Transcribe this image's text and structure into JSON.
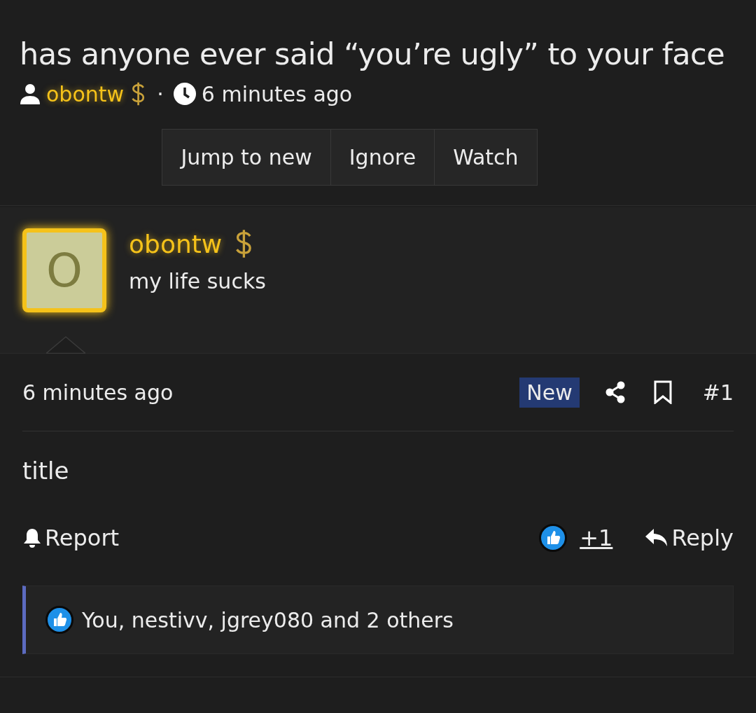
{
  "thread": {
    "title": "has anyone ever said “you’re ugly” to your face",
    "author": "obontw",
    "separator": "·",
    "time": "6 minutes ago"
  },
  "thread_buttons": [
    {
      "label": "Jump to new"
    },
    {
      "label": "Ignore"
    },
    {
      "label": "Watch"
    }
  ],
  "post": {
    "avatar_letter": "O",
    "username": "obontw",
    "user_title": "my life sucks",
    "time": "6 minutes ago",
    "badge": "New",
    "number": "#1",
    "body": "title",
    "report": "Report",
    "reaction_count": "+1",
    "reply": "Reply",
    "reactions": "You, nestivv, jgrey080 and 2 others"
  }
}
